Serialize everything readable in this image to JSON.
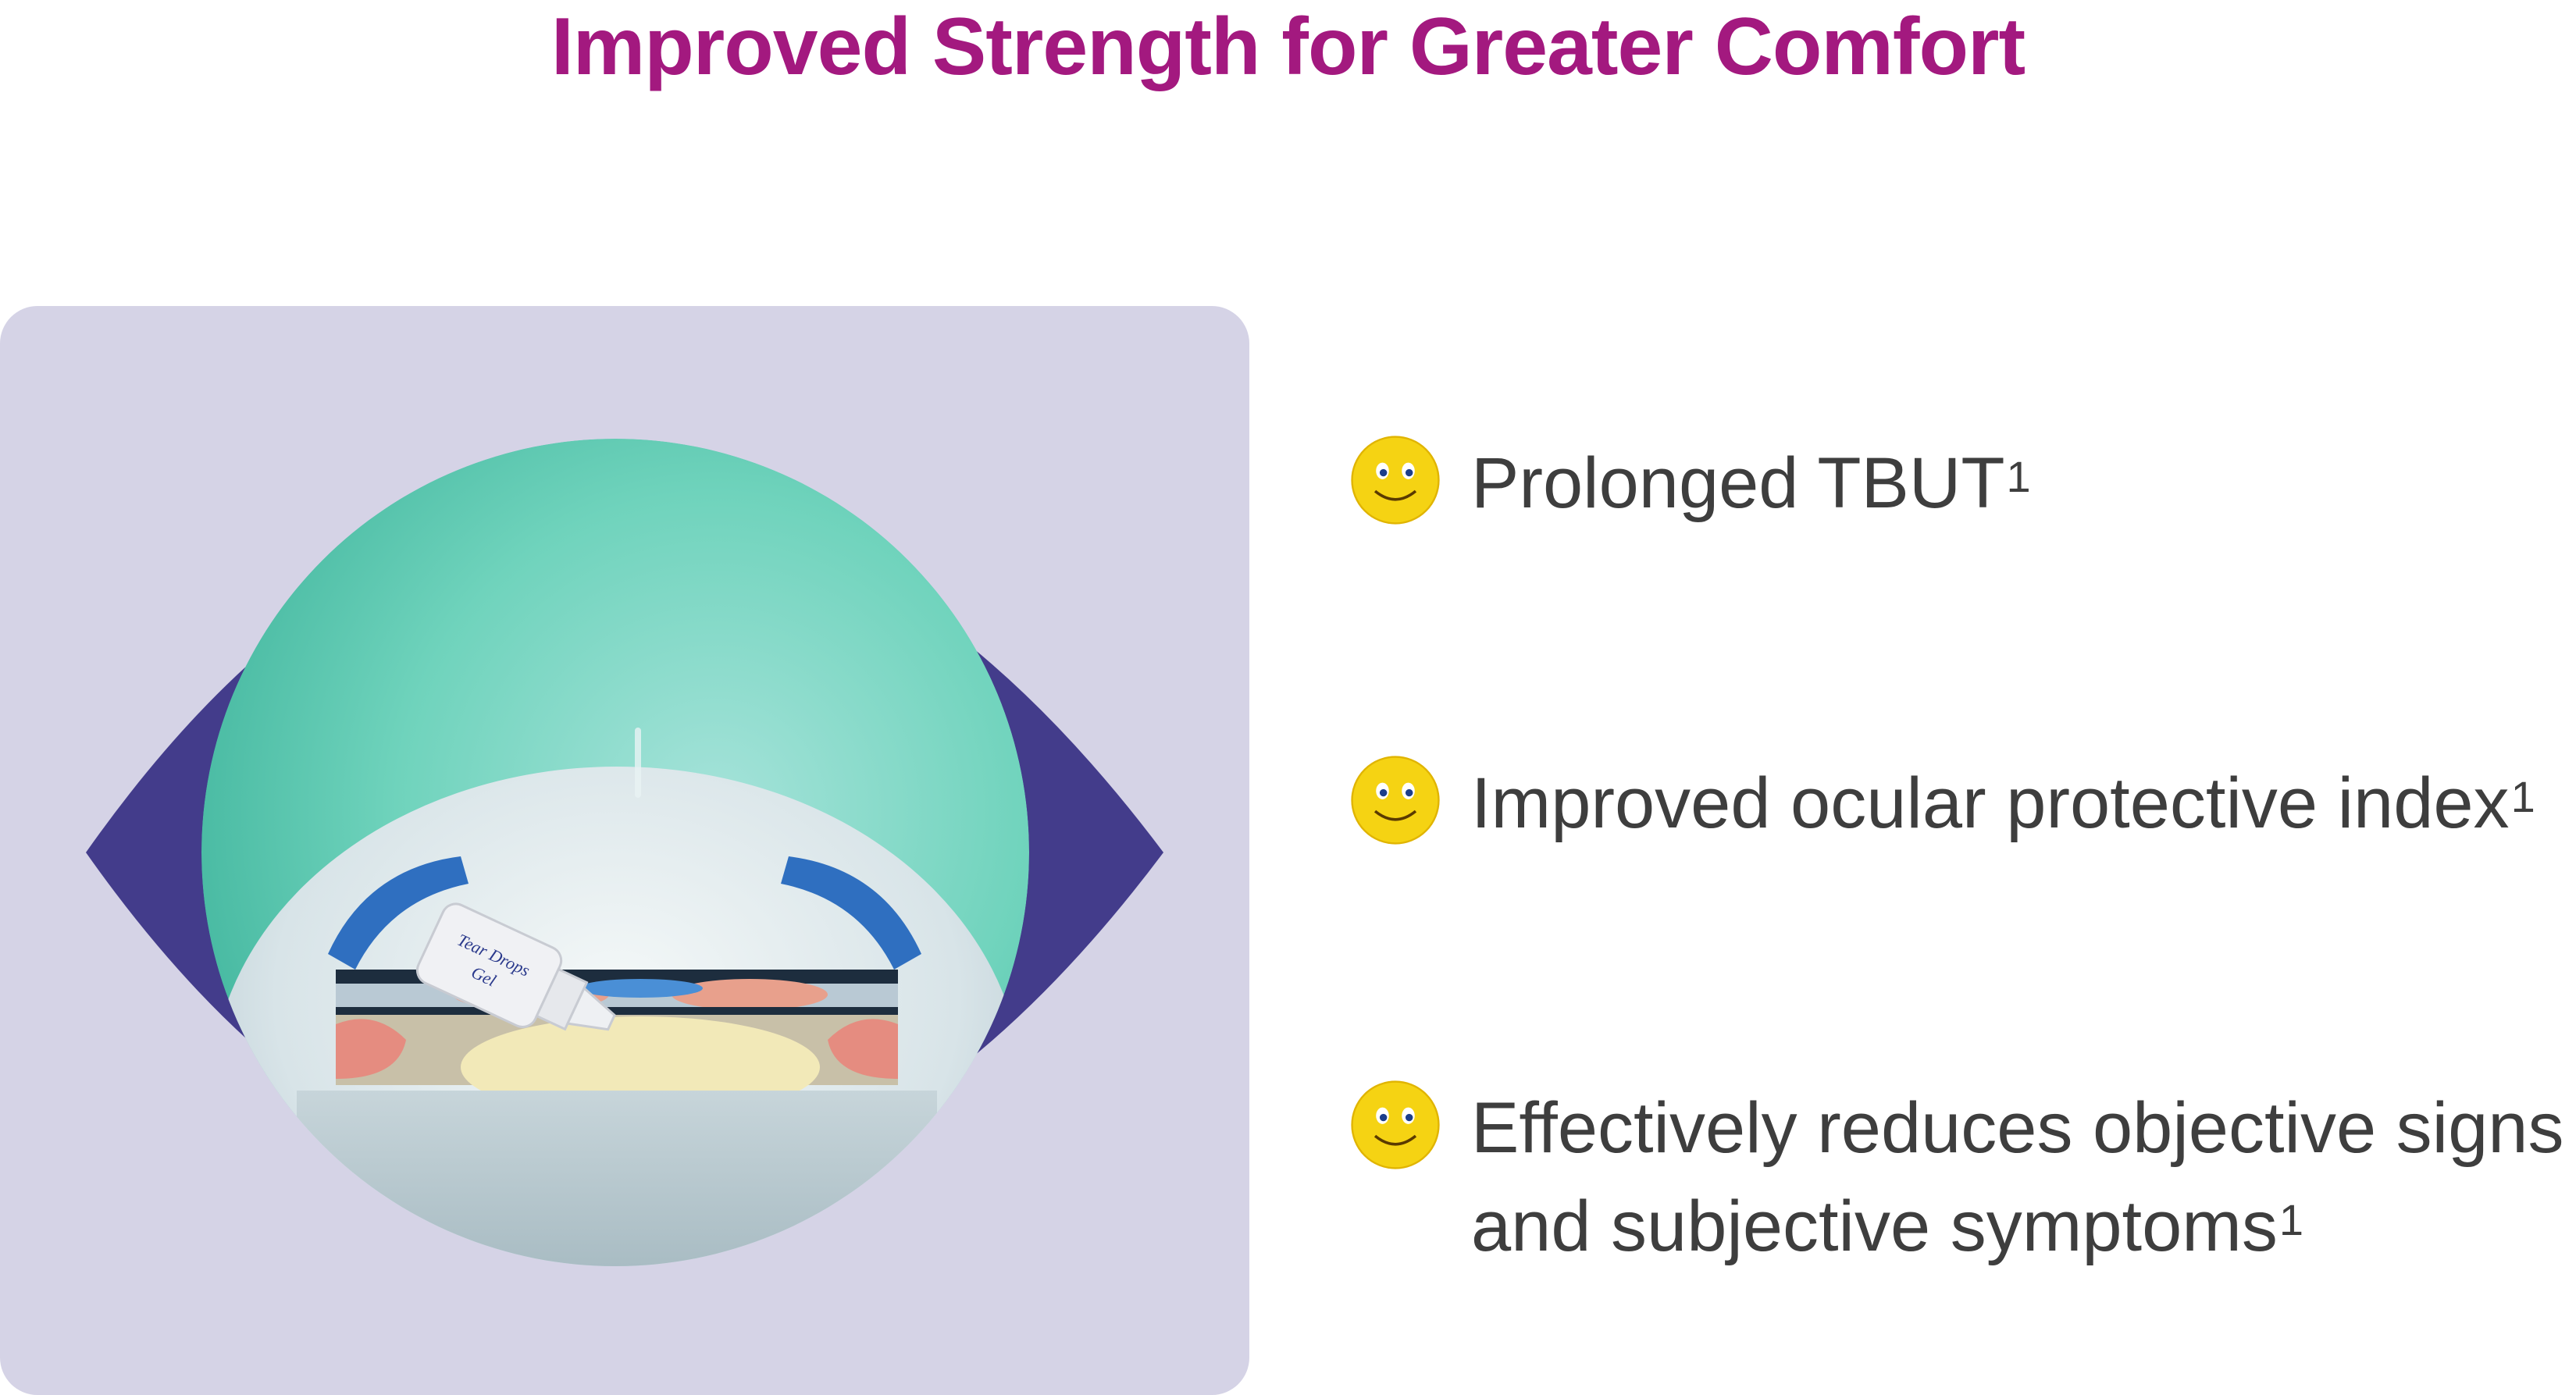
{
  "title": "Improved Strength for Greater Comfort",
  "colors": {
    "title": "#a3197f",
    "panel_bg": "#d5d3e6",
    "eye_outline": "#433c8b",
    "text": "#3e3e3e",
    "smiley": "#f5d313"
  },
  "illustration": {
    "bottle_label_line1": "Tear Drops",
    "bottle_label_line2": "Gel"
  },
  "benefits": [
    {
      "text": "Prolonged TBUT",
      "sup": "1",
      "icon": "smiley-face-icon"
    },
    {
      "text": "Improved ocular protective index",
      "sup": "1",
      "icon": "smiley-face-icon"
    },
    {
      "text_line1": "Effectively reduces objective signs",
      "text_line2": "and subjective symptoms",
      "sup": "1",
      "icon": "smiley-face-icon"
    }
  ]
}
